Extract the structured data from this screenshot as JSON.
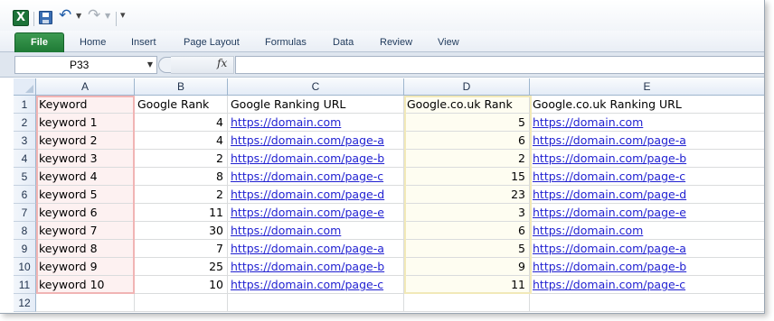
{
  "quick_access": {
    "app_icon": "excel-icon",
    "icons": [
      "save-icon",
      "undo-icon",
      "redo-icon",
      "customize-icon"
    ],
    "app_icon_letter": "X"
  },
  "ribbon": {
    "file_tab": "File",
    "tabs": [
      "Home",
      "Insert",
      "Page Layout",
      "Formulas",
      "Data",
      "Review",
      "View"
    ]
  },
  "formula_bar": {
    "name_box": "P33",
    "fx_label": "fx",
    "formula": ""
  },
  "sheet": {
    "columns": [
      "A",
      "B",
      "C",
      "D",
      "E"
    ],
    "row_numbers": [
      "1",
      "2",
      "3",
      "4",
      "5",
      "6",
      "7",
      "8",
      "9",
      "10",
      "11",
      "12"
    ],
    "headers": {
      "a": "Keyword",
      "b": "Google Rank",
      "c": "Google Ranking URL",
      "d": "Google.co.uk Rank",
      "e": "Google.co.uk Ranking URL"
    },
    "rows": [
      {
        "keyword": "keyword 1",
        "google_rank": "4",
        "google_url": "https://domain.com",
        "uk_rank": "5",
        "uk_url": "https://domain.com"
      },
      {
        "keyword": "keyword 2",
        "google_rank": "4",
        "google_url": "https://domain.com/page-a",
        "uk_rank": "6",
        "uk_url": "https://domain.com/page-a"
      },
      {
        "keyword": "keyword 3",
        "google_rank": "2",
        "google_url": "https://domain.com/page-b",
        "uk_rank": "2",
        "uk_url": "https://domain.com/page-b"
      },
      {
        "keyword": "keyword 4",
        "google_rank": "8",
        "google_url": "https://domain.com/page-c",
        "uk_rank": "15",
        "uk_url": "https://domain.com/page-c"
      },
      {
        "keyword": "keyword 5",
        "google_rank": "2",
        "google_url": "https://domain.com/page-d",
        "uk_rank": "23",
        "uk_url": "https://domain.com/page-d"
      },
      {
        "keyword": "keyword 6",
        "google_rank": "11",
        "google_url": "https://domain.com/page-e",
        "uk_rank": "3",
        "uk_url": "https://domain.com/page-e"
      },
      {
        "keyword": "keyword 7",
        "google_rank": "30",
        "google_url": "https://domain.com",
        "uk_rank": "6",
        "uk_url": "https://domain.com"
      },
      {
        "keyword": "keyword 8",
        "google_rank": "7",
        "google_url": "https://domain.com/page-a",
        "uk_rank": "5",
        "uk_url": "https://domain.com/page-a"
      },
      {
        "keyword": "keyword 9",
        "google_rank": "25",
        "google_url": "https://domain.com/page-b",
        "uk_rank": "9",
        "uk_url": "https://domain.com/page-b"
      },
      {
        "keyword": "keyword 10",
        "google_rank": "10",
        "google_url": "https://domain.com/page-c",
        "uk_rank": "11",
        "uk_url": "https://domain.com/page-c"
      }
    ],
    "colors": {
      "column_a_fill": "#fdf1f1",
      "column_a_border": "#f1b4b4",
      "column_d_fill": "#fefdf1",
      "column_d_border": "#f2e9b8",
      "link": "#1f1fd1",
      "file_tab": "#1e7a35"
    }
  }
}
